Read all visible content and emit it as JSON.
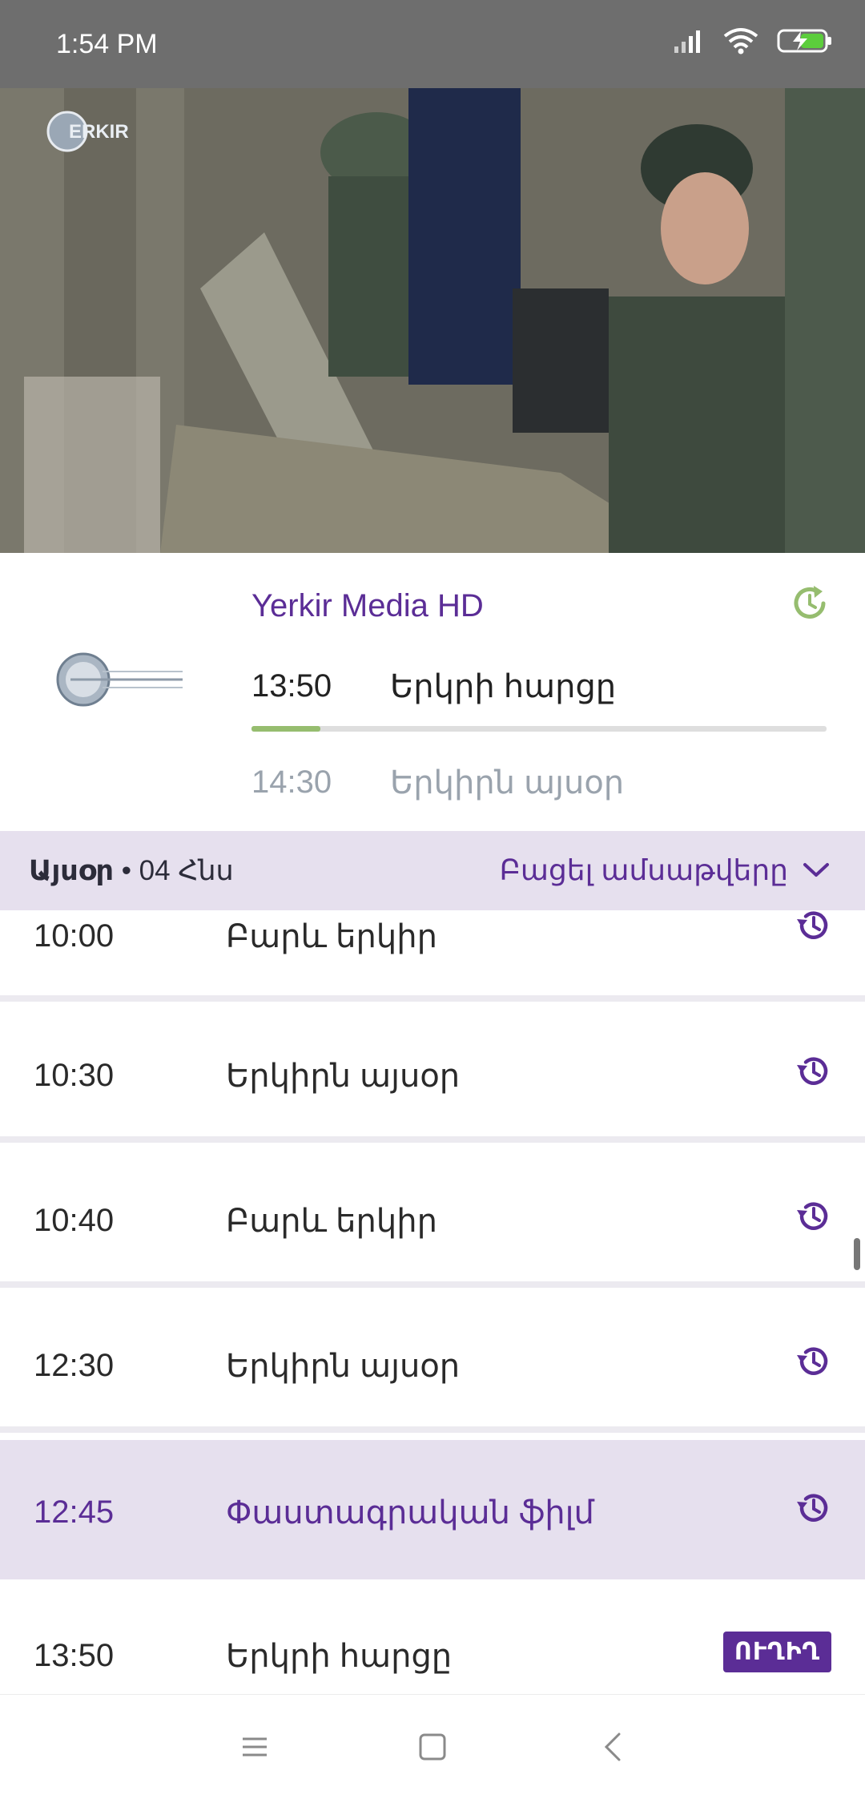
{
  "status_bar": {
    "time": "1:54 PM",
    "icons": [
      "signal-icon",
      "wifi-icon",
      "battery-charging-icon"
    ]
  },
  "video": {
    "watermark_text": "ERKIR"
  },
  "now_playing": {
    "channel_name": "Yerkir Media HD",
    "current": {
      "time": "13:50",
      "title": "Երկրի հարցը"
    },
    "next": {
      "time": "14:30",
      "title": "Երկիրն այսօր"
    },
    "progress_fraction": 0.12,
    "progress_color": "#96bd6f",
    "accent_color": "#5b2d96"
  },
  "day_bar": {
    "day": "Այսօր",
    "date": " • 04 Հնս",
    "open_all_label": "Բացել ամսաթվերը"
  },
  "schedule": [
    {
      "time": "10:00",
      "title": "Բարև երկիր",
      "icon": "history-icon"
    },
    {
      "time": "10:30",
      "title": "Երկիրն այսօր",
      "icon": "history-icon"
    },
    {
      "time": "10:40",
      "title": "Բարև երկիր",
      "icon": "history-icon"
    },
    {
      "time": "12:30",
      "title": "Երկիրն այսօր",
      "icon": "history-icon"
    },
    {
      "time": "12:45",
      "title": "Փաստագրական ֆիլմ",
      "icon": "history-icon",
      "highlighted": true
    },
    {
      "time": "13:50",
      "title": "Երկրի հարցը",
      "badge": "ՈՒՂԻՂ"
    }
  ],
  "nav_bar": {
    "buttons": [
      "menu-icon",
      "home-icon",
      "back-icon"
    ]
  }
}
